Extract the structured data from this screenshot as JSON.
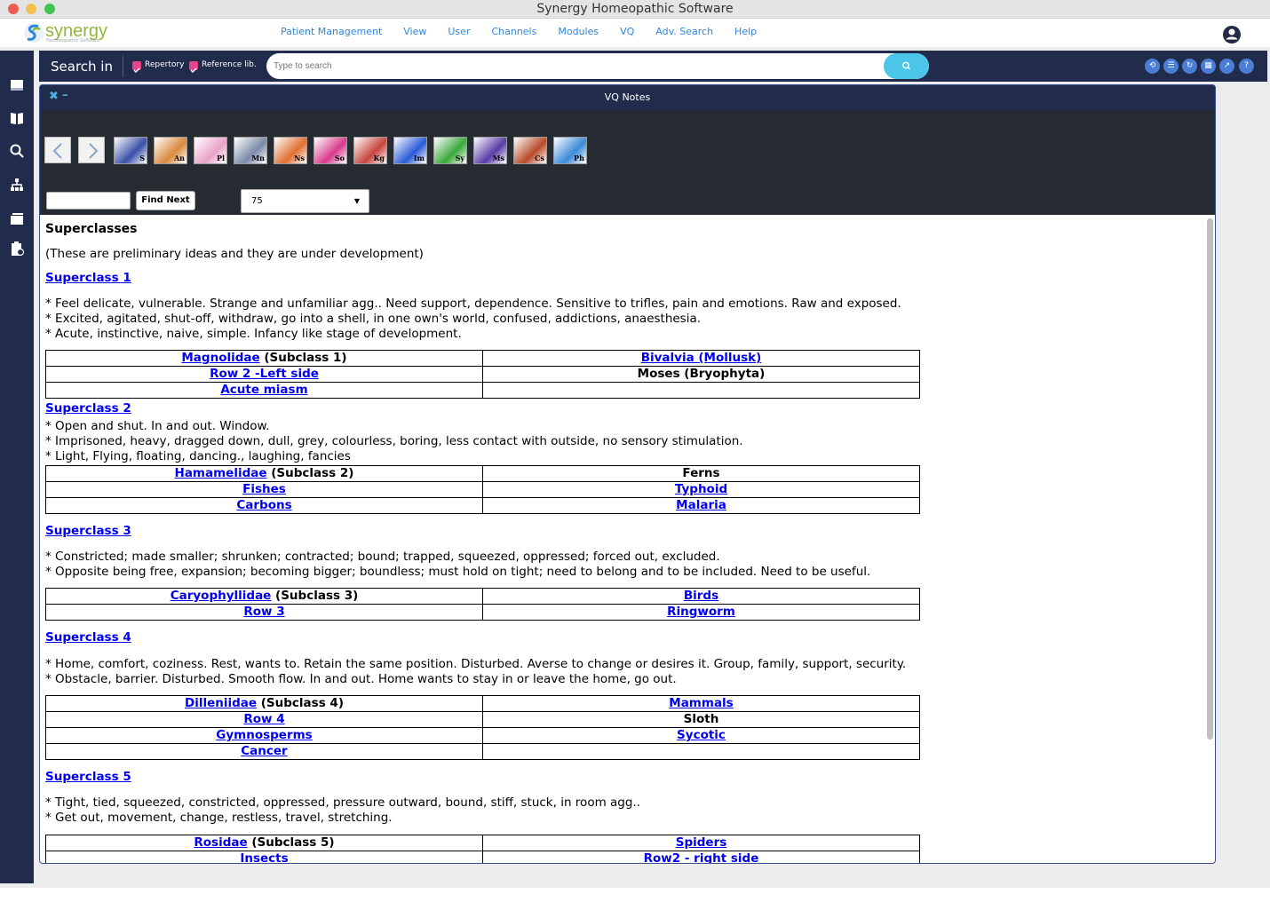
{
  "window": {
    "title": "Synergy Homeopathic Software"
  },
  "logo": {
    "name": "synergy",
    "tagline": "Homoeopathic Software"
  },
  "nav": [
    "Patient Management",
    "View",
    "User",
    "Channels",
    "Modules",
    "VQ",
    "Adv. Search",
    "Help"
  ],
  "search": {
    "label": "Search in",
    "options": [
      {
        "label": "Repertory",
        "checked": true
      },
      {
        "label": "Reference lib.",
        "checked": true
      }
    ],
    "placeholder": "Type to search"
  },
  "panel": {
    "title": "VQ Notes"
  },
  "toolbar": {
    "books": [
      "S",
      "An",
      "Pl",
      "Mn",
      "Ns",
      "So",
      "Kg",
      "Im",
      "Sy",
      "Ms",
      "Cs",
      "Ph"
    ],
    "find_next": "Find Next",
    "zoom": "75"
  },
  "doc": {
    "title": "Superclasses",
    "intro": "(These are preliminary ideas and they are under development)",
    "sections": [
      {
        "heading": "Superclass 1",
        "lines": [
          "* Feel delicate, vulnerable. Strange and unfamiliar agg.. Need support, dependence. Sensitive to trifles, pain and emotions. Raw and exposed.",
          "* Excited, agitated, shut-off, withdraw, go into a shell, in one own's world, confused, addictions, anaesthesia.",
          "* Acute, instinctive, naive, simple. Infancy like stage of development."
        ],
        "rows": [
          [
            {
              "link": "Magnolidae",
              "suffix": " (Subclass 1)"
            },
            {
              "link": "Bivalvia (Mollusk)"
            }
          ],
          [
            {
              "link": "Row 2 -Left side"
            },
            {
              "text": "Moses (Bryophyta)"
            }
          ],
          [
            {
              "link": "Acute miasm"
            },
            {
              "text": ""
            }
          ]
        ]
      },
      {
        "heading": "Superclass 2",
        "lines": [
          "* Open and shut. In and out. Window.",
          "* Imprisoned, heavy, dragged down, dull, grey, colourless, boring, less contact with outside, no sensory stimulation.",
          "* Light, Flying, floating, dancing., laughing, fancies"
        ],
        "rows": [
          [
            {
              "link": "Hamamelidae",
              "suffix": " (Subclass 2)"
            },
            {
              "text": "Ferns"
            }
          ],
          [
            {
              "link": "Fishes"
            },
            {
              "link": "Typhoid"
            }
          ],
          [
            {
              "link": "Carbons"
            },
            {
              "link": "Malaria"
            }
          ]
        ]
      },
      {
        "heading": "Superclass 3",
        "lines": [
          "* Constricted; made smaller; shrunken; contracted; bound; trapped, squeezed, oppressed; forced out, excluded.",
          "* Opposite being free, expansion; becoming bigger; boundless; must hold on tight; need to belong and to be included. Need to be useful."
        ],
        "rows": [
          [
            {
              "link": "Caryophyllidae",
              "suffix": " (Subclass 3)"
            },
            {
              "link": "Birds"
            }
          ],
          [
            {
              "link": "Row 3"
            },
            {
              "link": "Ringworm"
            }
          ]
        ]
      },
      {
        "heading": "Superclass 4",
        "lines": [
          "* Home, comfort, coziness. Rest, wants to. Retain the same position. Disturbed. Averse to change or desires it. Group, family, support, security.",
          "* Obstacle, barrier. Disturbed. Smooth flow. In and out. Home wants to stay in or leave the home, go out."
        ],
        "rows": [
          [
            {
              "link": "Dilleniidae",
              "suffix": " (Subclass 4)"
            },
            {
              "link": "Mammals"
            }
          ],
          [
            {
              "link": "Row 4"
            },
            {
              "text": "Sloth"
            }
          ],
          [
            {
              "link": "Gymnosperms"
            },
            {
              "link": "Sycotic"
            }
          ],
          [
            {
              "link": "Cancer"
            },
            {
              "text": ""
            }
          ]
        ]
      },
      {
        "heading": "Superclass 5",
        "lines": [
          "* Tight, tied, squeezed, constricted, oppressed, pressure outward, bound, stiff, stuck, in room agg..",
          "* Get out, movement, change, restless, travel, stretching."
        ],
        "rows": [
          [
            {
              "link": "Rosidae",
              "suffix": " (Subclass 5)"
            },
            {
              "link": "Spiders"
            }
          ],
          [
            {
              "link": "Insects"
            },
            {
              "link": "Row2 - right side"
            }
          ]
        ]
      }
    ]
  }
}
